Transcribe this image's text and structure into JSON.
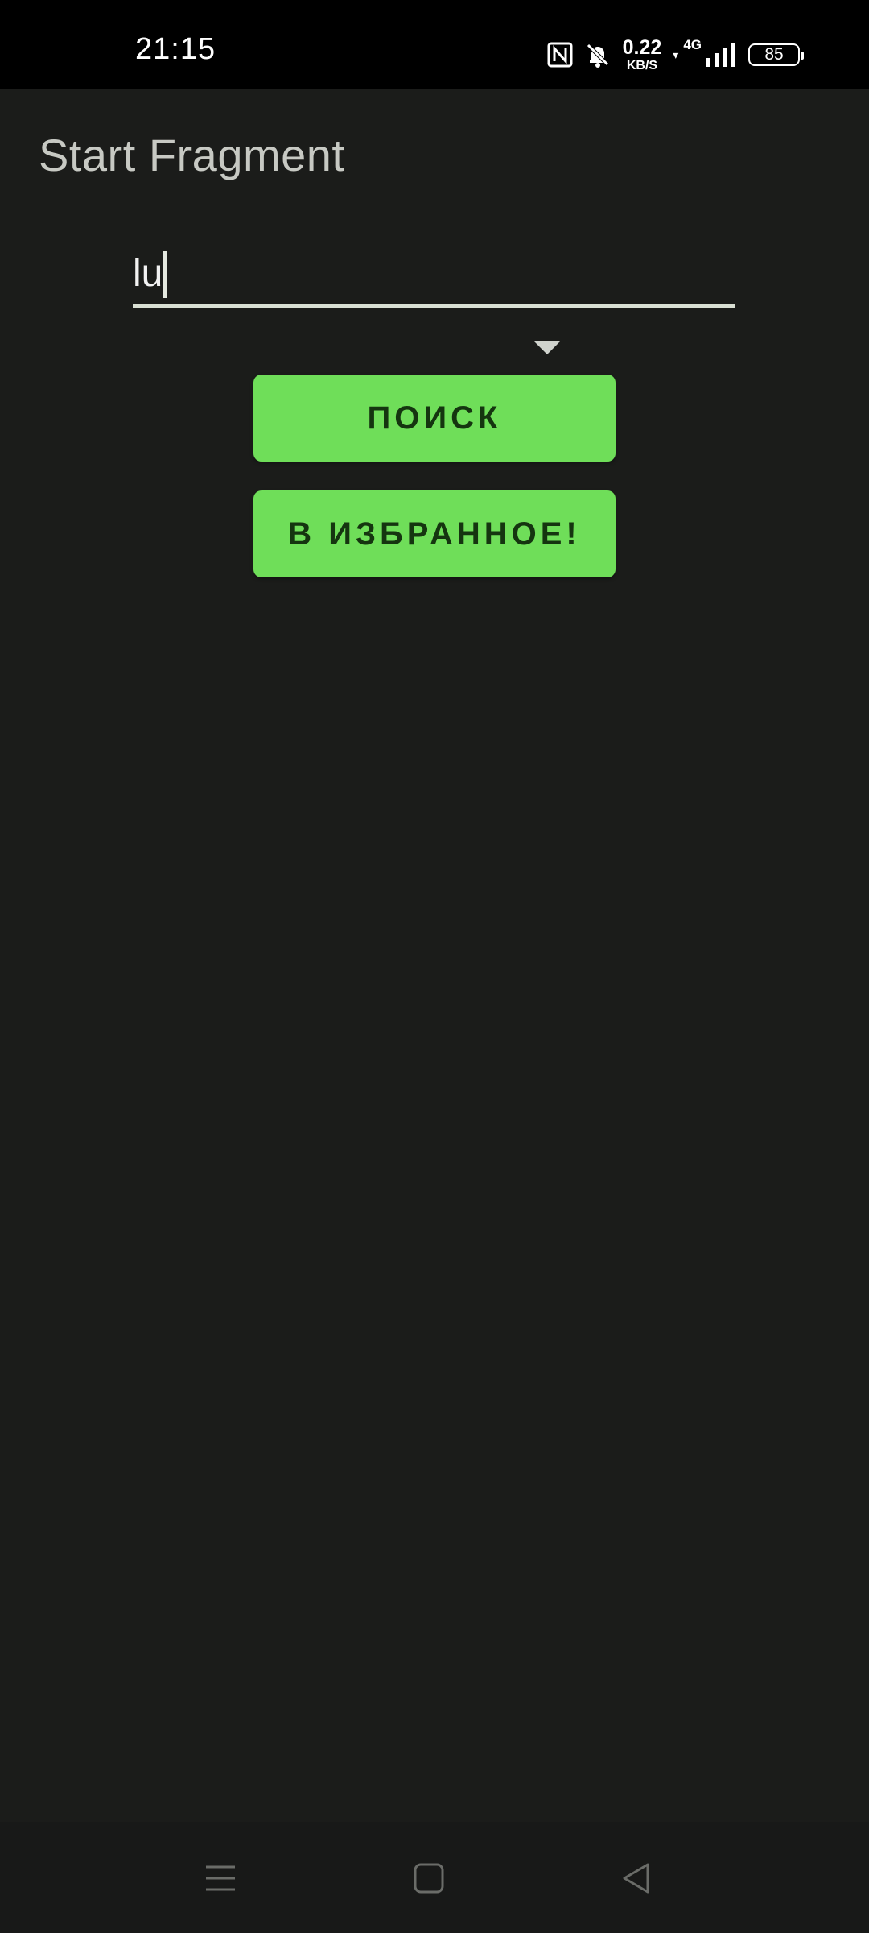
{
  "status_bar": {
    "time": "21:15",
    "net_speed_value": "0.22",
    "net_speed_unit": "KB/S",
    "network_type": "4G",
    "battery_level": "85",
    "icons": [
      "nfc-icon",
      "bell-off-icon",
      "data-arrow-icon",
      "signal-icon",
      "battery-icon"
    ]
  },
  "page": {
    "title": "Start Fragment"
  },
  "search": {
    "value": "lu",
    "placeholder": ""
  },
  "dropdown": {
    "icon": "chevron-down-icon"
  },
  "buttons": {
    "search_label": "ПОИСК",
    "favorite_label": "В ИЗБРАННОЕ!"
  },
  "nav_bar": {
    "icons": [
      "menu-icon",
      "home-icon",
      "back-icon"
    ]
  },
  "colors": {
    "background": "#1b1c1a",
    "accent_button": "#6fde59",
    "button_text": "#153510",
    "title_text": "#c7c9c3"
  }
}
